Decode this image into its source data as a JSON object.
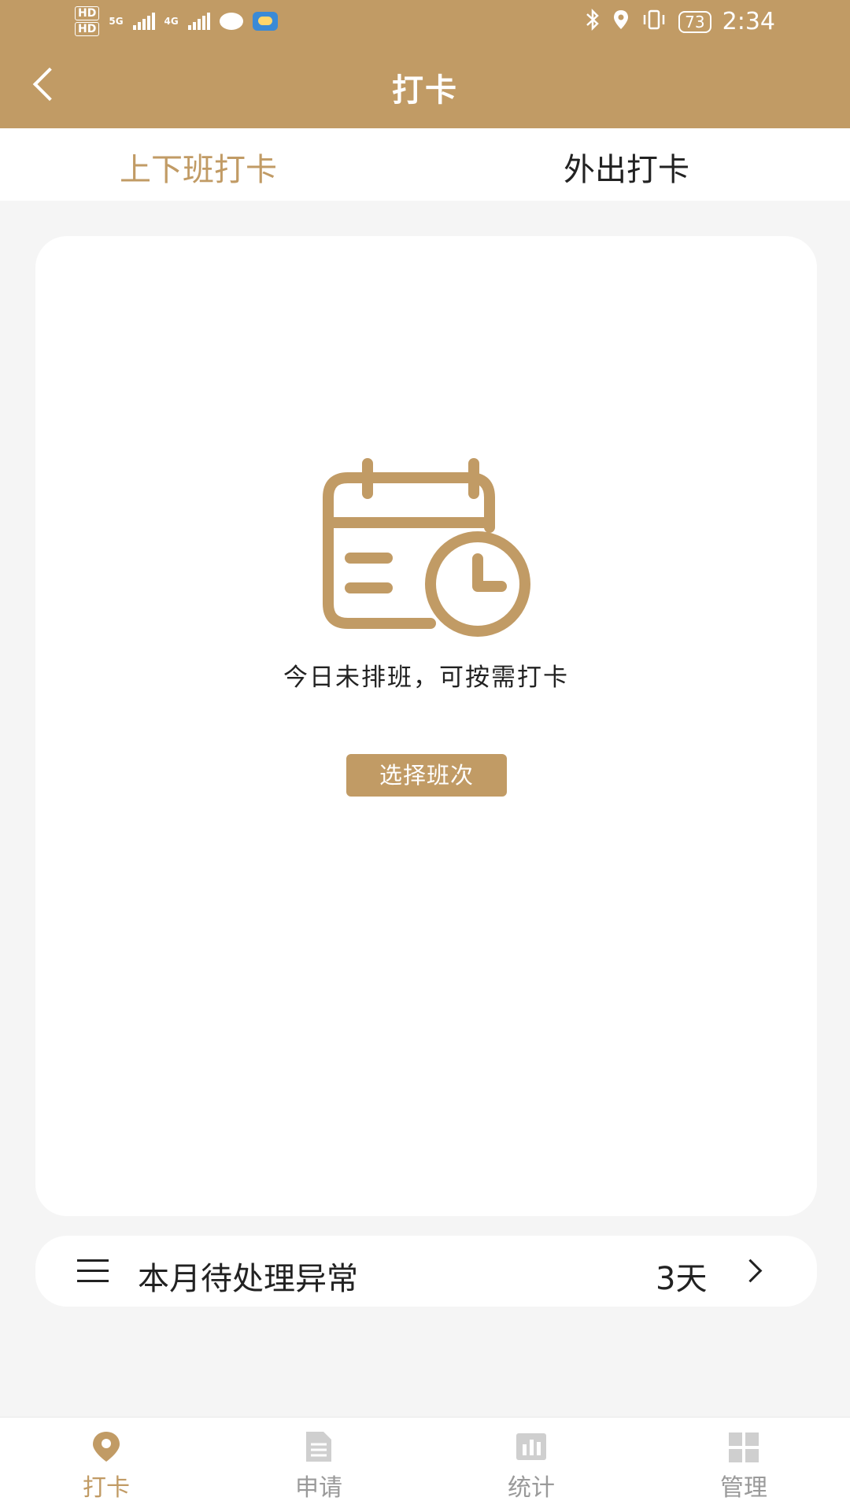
{
  "status_bar": {
    "hd1": "HD",
    "hd2": "HD",
    "net1": "5G",
    "net2": "4G",
    "battery": "73",
    "time": "2:34"
  },
  "header": {
    "title": "打卡"
  },
  "tabs": [
    {
      "label": "上下班打卡",
      "active": true
    },
    {
      "label": "外出打卡",
      "active": false
    }
  ],
  "empty_state": {
    "message": "今日未排班，可按需打卡",
    "button_label": "选择班次"
  },
  "anomaly": {
    "label": "本月待处理异常",
    "count": "3天"
  },
  "bottom_nav": [
    {
      "label": "打卡",
      "icon": "location-pin-icon",
      "active": true
    },
    {
      "label": "申请",
      "icon": "document-icon",
      "active": false
    },
    {
      "label": "统计",
      "icon": "bar-chart-icon",
      "active": false
    },
    {
      "label": "管理",
      "icon": "grid-icon",
      "active": false
    }
  ],
  "colors": {
    "accent": "#c19b65",
    "inactive": "#9a9a9a",
    "background": "#f5f5f5"
  }
}
